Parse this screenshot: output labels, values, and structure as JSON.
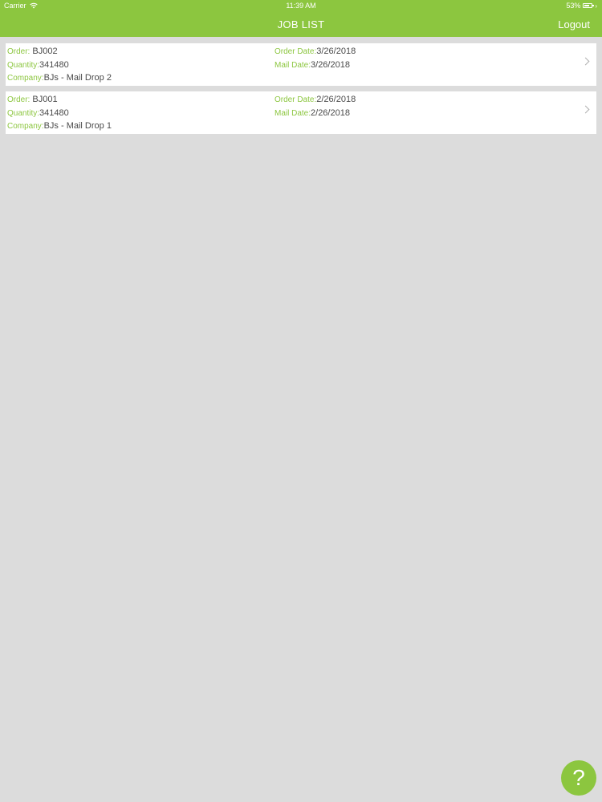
{
  "status_bar": {
    "carrier": "Carrier",
    "time": "11:39 AM",
    "battery": "53%",
    "icons": [
      "wifi-icon",
      "battery-icon",
      "charging-icon"
    ]
  },
  "nav": {
    "title": "JOB LIST",
    "logout_label": "Logout",
    "accent_color": "#8cc63f"
  },
  "jobs": [
    {
      "order_label": "Order:",
      "order": "BJ002",
      "quantity_label": "Quantity:",
      "quantity": "341480",
      "company_label": "Company:",
      "company": "BJs - Mail Drop 2",
      "order_date_label": "Order Date:",
      "order_date": "3/26/2018",
      "mail_date_label": "Mail Date:",
      "mail_date": "3/26/2018"
    },
    {
      "order_label": "Order:",
      "order": "BJ001",
      "quantity_label": "Quantity:",
      "quantity": "341480",
      "company_label": "Company:",
      "company": "BJs - Mail Drop 1",
      "order_date_label": "Order Date:",
      "order_date": "2/26/2018",
      "mail_date_label": "Mail Date:",
      "mail_date": "2/26/2018"
    }
  ],
  "help_button": {
    "label": "?"
  }
}
